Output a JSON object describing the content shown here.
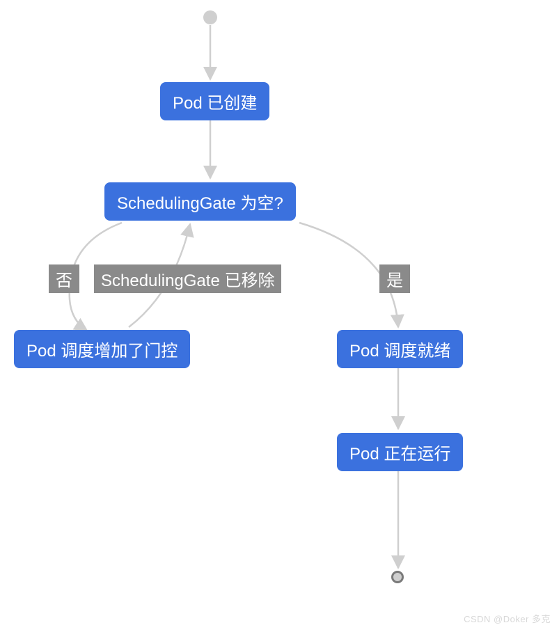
{
  "chart_data": {
    "type": "flowchart",
    "nodes": [
      {
        "id": "start",
        "kind": "start",
        "label": ""
      },
      {
        "id": "created",
        "kind": "process",
        "label": "Pod 已创建"
      },
      {
        "id": "decision",
        "kind": "decision",
        "label": "SchedulingGate 为空?"
      },
      {
        "id": "gated",
        "kind": "process",
        "label": "Pod 调度增加了门控"
      },
      {
        "id": "ready",
        "kind": "process",
        "label": "Pod 调度就绪"
      },
      {
        "id": "running",
        "kind": "process",
        "label": "Pod 正在运行"
      },
      {
        "id": "end",
        "kind": "end",
        "label": ""
      }
    ],
    "edges": [
      {
        "from": "start",
        "to": "created",
        "label": ""
      },
      {
        "from": "created",
        "to": "decision",
        "label": ""
      },
      {
        "from": "decision",
        "to": "gated",
        "label": "否"
      },
      {
        "from": "decision",
        "to": "ready",
        "label": "是"
      },
      {
        "from": "gated",
        "to": "decision",
        "label": "SchedulingGate 已移除"
      },
      {
        "from": "ready",
        "to": "running",
        "label": ""
      },
      {
        "from": "running",
        "to": "end",
        "label": ""
      }
    ]
  },
  "watermark": "CSDN @Doker 多克",
  "colors": {
    "node_bg": "#3b71de",
    "node_text": "#ffffff",
    "edge_label_bg": "#8a8a8a",
    "edge": "#cfcfcf"
  }
}
